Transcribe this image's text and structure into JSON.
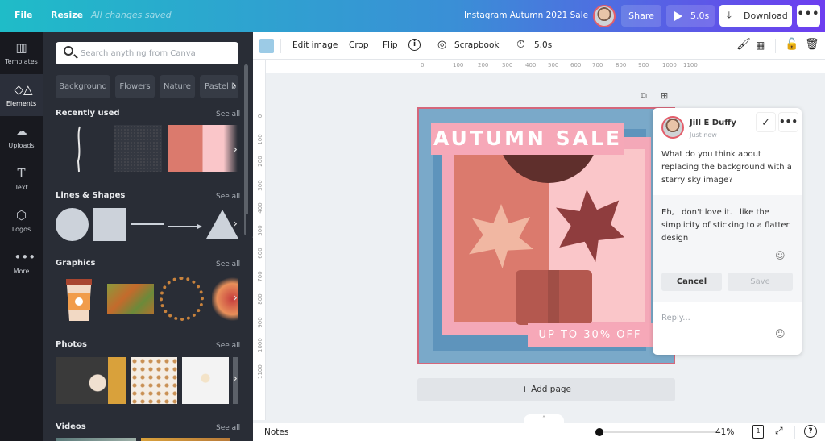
{
  "topbar": {
    "file_label": "File",
    "resize_label": "Resize",
    "save_status": "All changes saved",
    "design_title": "Instagram Autumn 2021 Sale",
    "share_label": "Share",
    "play_label": "5.0s",
    "download_label": "Download",
    "more_label": "•••"
  },
  "rail": {
    "items": [
      {
        "label": "Templates",
        "icon": "templates-icon"
      },
      {
        "label": "Elements",
        "icon": "elements-icon"
      },
      {
        "label": "Uploads",
        "icon": "upload-cloud-icon"
      },
      {
        "label": "Text",
        "icon": "text-icon"
      },
      {
        "label": "Logos",
        "icon": "logo-icon"
      },
      {
        "label": "More",
        "icon": "more-dots-icon"
      }
    ],
    "active": "Elements"
  },
  "panel": {
    "search_placeholder": "Search anything from Canva",
    "chips": [
      "Background",
      "Flowers",
      "Nature",
      "Pastel b"
    ],
    "see_all": "See all",
    "sections": {
      "recent": "Recently used",
      "lines_shapes": "Lines & Shapes",
      "graphics": "Graphics",
      "photos": "Photos",
      "videos": "Videos"
    }
  },
  "context_toolbar": {
    "swatch_color": "#9ccbe6",
    "edit_image": "Edit image",
    "crop": "Crop",
    "flip": "Flip",
    "info": "i",
    "scrapbook": "Scrapbook",
    "timing": "5.0s"
  },
  "rulers": {
    "horizontal": [
      "0",
      "100",
      "200",
      "300",
      "400",
      "500",
      "600",
      "700",
      "800",
      "900",
      "1000",
      "1100"
    ],
    "vertical": [
      "0",
      "100",
      "200",
      "300",
      "400",
      "500",
      "600",
      "700",
      "800",
      "900",
      "1000",
      "1100"
    ]
  },
  "design": {
    "headline": "AUTUMN SALE",
    "offer": "UP TO 30% OFF"
  },
  "comment": {
    "author": "Jill E Duffy",
    "time": "Just now",
    "message": "What do you think about replacing the background with a starry sky image?",
    "reply_draft": "Eh, I don't love it. I like the simplicity of sticking to a flatter design",
    "cancel_label": "Cancel",
    "save_label": "Save",
    "reply_placeholder": "Reply..."
  },
  "add_page_label": "+ Add page",
  "bottombar": {
    "notes_label": "Notes",
    "zoom_level": "41%",
    "page_count": "1",
    "help": "?"
  }
}
